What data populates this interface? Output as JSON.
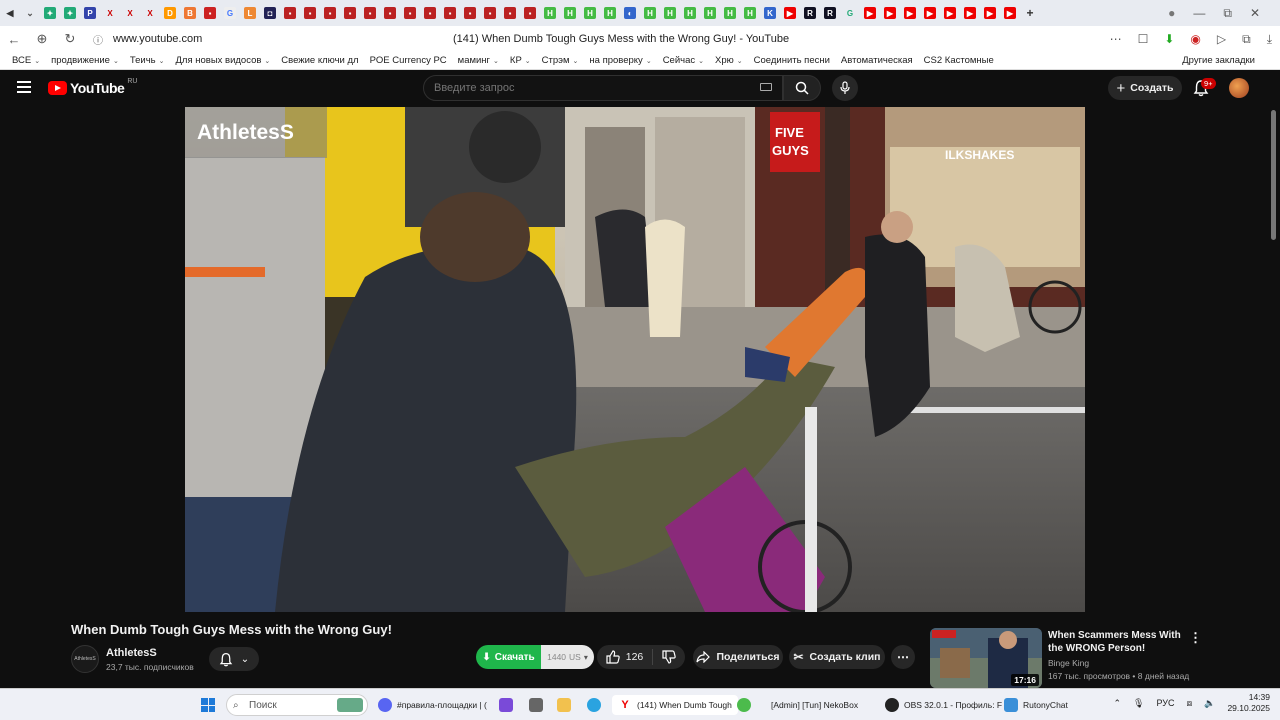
{
  "browser": {
    "url": "www.youtube.com",
    "page_title": "(141) When Dumb Tough Guys Mess with the Wrong Guy! - YouTube",
    "bookmarks": [
      {
        "label": "ВСЕ",
        "caret": true
      },
      {
        "label": "продвижение",
        "caret": true
      },
      {
        "label": "Теичь",
        "caret": true
      },
      {
        "label": "Для новых видосов",
        "caret": true
      },
      {
        "label": "Свежие ключи дл",
        "caret": false
      },
      {
        "label": "POE Currency PC",
        "caret": false
      },
      {
        "label": "маминг",
        "caret": true
      },
      {
        "label": "КР",
        "caret": true
      },
      {
        "label": "Стрэм",
        "caret": true
      },
      {
        "label": "на проверку",
        "caret": true
      },
      {
        "label": "Сейчас",
        "caret": true
      },
      {
        "label": "Хрю",
        "caret": true
      },
      {
        "label": "Соединить песни",
        "caret": false
      },
      {
        "label": "Автоматическая",
        "caret": false
      },
      {
        "label": "CS2 Кастомные",
        "caret": false
      }
    ],
    "other_bookmarks": "Другие закладки"
  },
  "youtube": {
    "logo_text": "YouTube",
    "region": "RU",
    "search_placeholder": "Введите запрос",
    "create_label": "Создать",
    "notifications_badge": "9+"
  },
  "video": {
    "watermark": "AthletesS",
    "title": "When Dumb Tough Guys Mess with the Wrong Guy!",
    "channel_name": "AthletesS",
    "channel_avatar_text": "AthletesS",
    "subscribers": "23,7 тыс. подписчиков",
    "download_label": "Скачать",
    "download_quality": "1440",
    "download_unit": "US",
    "likes": "126",
    "share_label": "Поделиться",
    "clip_label": "Создать клип"
  },
  "recommendation": {
    "title": "When Scammers Mess With the WRONG Person!",
    "channel": "Binge King",
    "meta": "167 тыс. просмотров • 8 дней назад",
    "duration": "17:16"
  },
  "taskbar": {
    "search_placeholder": "Поиск",
    "items": [
      {
        "label": "#правила-площадки | ("
      },
      {
        "label": "(141) When Dumb Tough"
      },
      {
        "label": "[Admin] [Tun] NekoBox"
      },
      {
        "label": "OBS 32.0.1 - Профиль: F"
      },
      {
        "label": "RutonyChat"
      }
    ],
    "language": "РУС",
    "time": "14:39",
    "date": "29.10.2025"
  },
  "colors": {
    "youtube_red": "#ff0000",
    "download_green": "#1fb64b",
    "background": "#0f0f0f"
  }
}
